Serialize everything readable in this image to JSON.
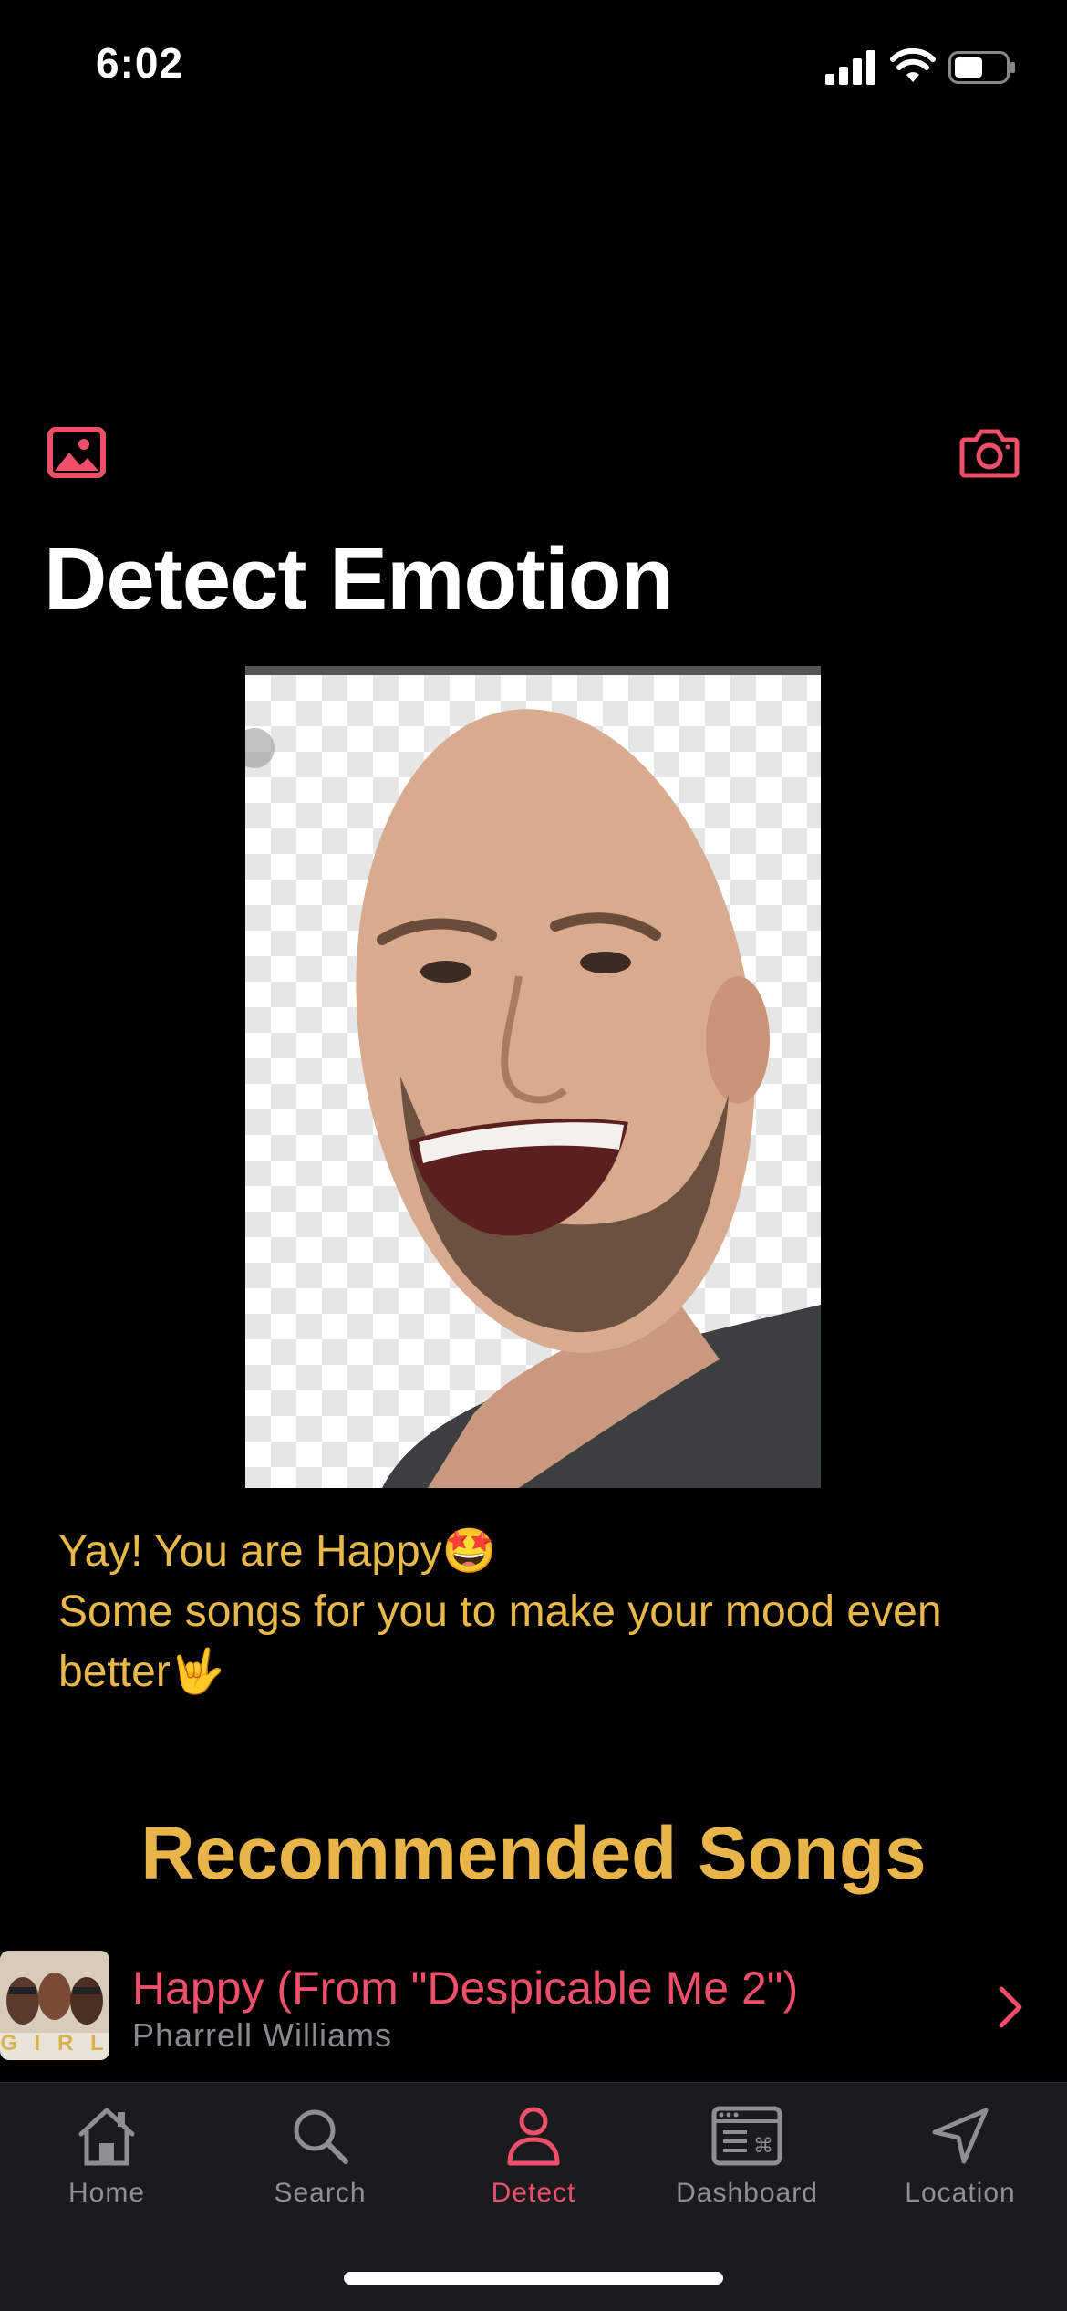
{
  "status_bar": {
    "time": "6:02",
    "icons": [
      "cellular-signal-icon",
      "wifi-icon",
      "battery-icon"
    ]
  },
  "toolbar": {
    "left_icon": "photo-gallery-icon",
    "right_icon": "camera-icon"
  },
  "page": {
    "title": "Detect Emotion"
  },
  "result": {
    "line1": "Yay! You are Happy🤩",
    "line2": "Some songs for you to make your mood even",
    "line3": "better🤟"
  },
  "recommended": {
    "heading": "Recommended Songs",
    "songs": [
      {
        "title": "Happy (From \"Despicable Me 2\")",
        "artist": "Pharrell Williams",
        "album_art_text": "G I R L"
      }
    ]
  },
  "tabbar": {
    "tabs": [
      {
        "label": "Home",
        "icon": "house-icon"
      },
      {
        "label": "Search",
        "icon": "magnifier-icon"
      },
      {
        "label": "Detect",
        "icon": "person-icon",
        "active": true
      },
      {
        "label": "Dashboard",
        "icon": "dashboard-icon"
      },
      {
        "label": "Location",
        "icon": "location-arrow-icon"
      }
    ]
  },
  "colors": {
    "accent": "#ef4f6a",
    "highlight": "#e9b44a",
    "background": "#000000",
    "tabbar": "#1b1b1d"
  }
}
